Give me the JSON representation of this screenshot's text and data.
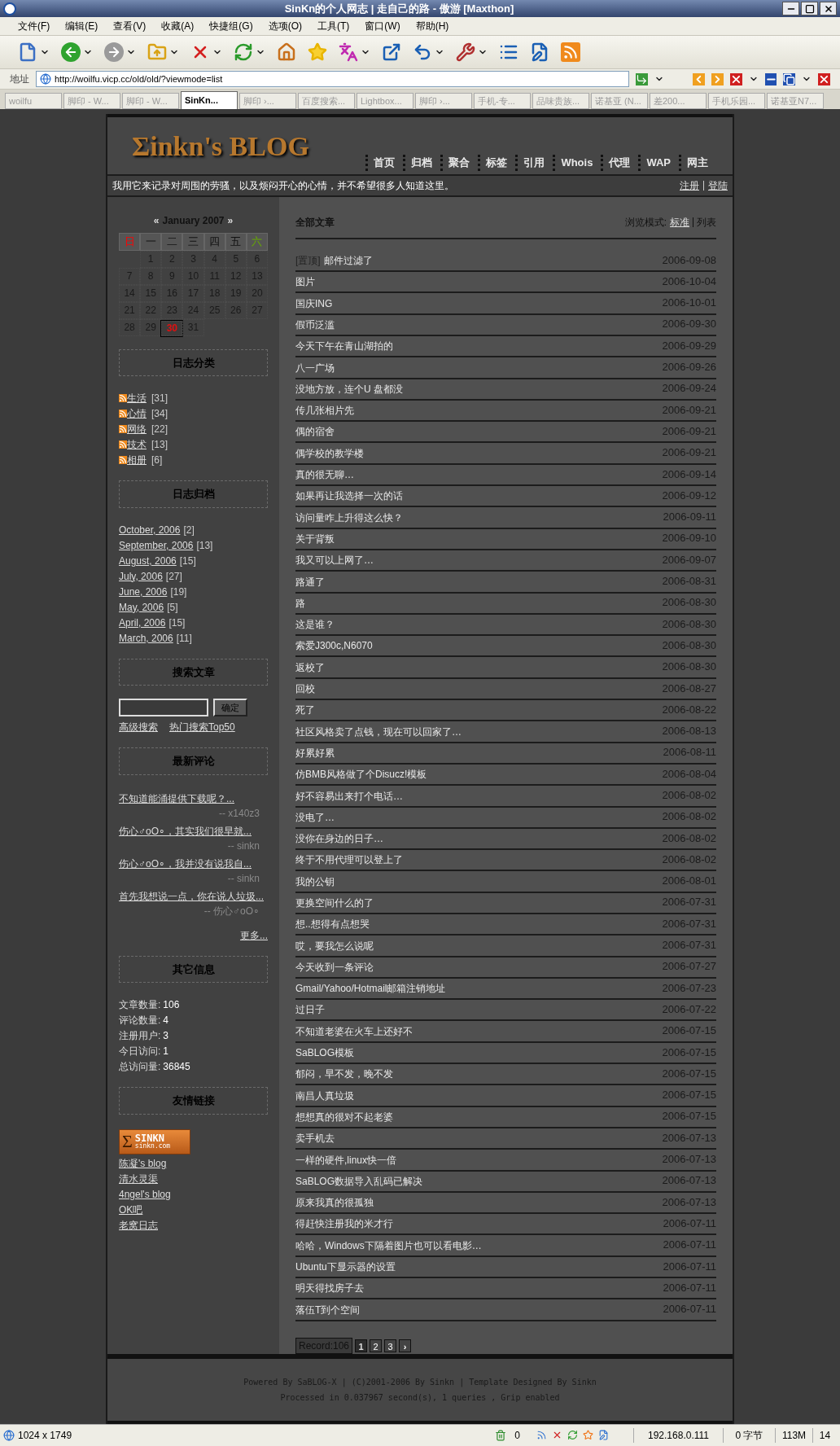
{
  "window": {
    "title": "SinKn的个人网志 | 走自己的路 - 傲游 [Maxthon]"
  },
  "menu": [
    "文件(F)",
    "编辑(E)",
    "查看(V)",
    "收藏(A)",
    "快捷组(G)",
    "选项(O)",
    "工具(T)",
    "窗口(W)",
    "帮助(H)"
  ],
  "address_bar": {
    "label": "地址",
    "url": "http://woilfu.vicp.cc/old/old/?viewmode=list"
  },
  "tabs": [
    {
      "label": "woilfu",
      "selected": false
    },
    {
      "label": "脚印 - W...",
      "selected": false
    },
    {
      "label": "脚印 - W...",
      "selected": false
    },
    {
      "label": "SinKn...",
      "selected": true
    },
    {
      "label": "脚印 ›...",
      "selected": false
    },
    {
      "label": "百度搜索...",
      "selected": false
    },
    {
      "label": "Lightbox...",
      "selected": false
    },
    {
      "label": "脚印 ›...",
      "selected": false
    },
    {
      "label": "手机-专...",
      "selected": false
    },
    {
      "label": "品味贵族...",
      "selected": false
    },
    {
      "label": "诺基亚 (N...",
      "selected": false
    },
    {
      "label": "差200...",
      "selected": false
    },
    {
      "label": "手机乐园...",
      "selected": false
    },
    {
      "label": "诺基亚N7...",
      "selected": false
    }
  ],
  "blog": {
    "logo": "Σinkn's BLOG",
    "nav": [
      "首页",
      "归档",
      "聚合",
      "标签",
      "引用",
      "Whois",
      "代理",
      "WAP",
      "网主"
    ],
    "tagline": "我用它来记录对周围的劳骚，以及烦闷开心的心情，并不希望很多人知道这里。",
    "account_links": [
      "注册",
      "登陆"
    ]
  },
  "calendar": {
    "prev": "«",
    "title": "January 2007",
    "next": "»",
    "weekdays": [
      {
        "label": "日",
        "kind": "sunday"
      },
      {
        "label": "一",
        "kind": "weekday"
      },
      {
        "label": "二",
        "kind": "weekday"
      },
      {
        "label": "三",
        "kind": "weekday"
      },
      {
        "label": "四",
        "kind": "weekday"
      },
      {
        "label": "五",
        "kind": "weekday"
      },
      {
        "label": "六",
        "kind": "saturday"
      }
    ],
    "days": [
      {
        "kind": "blank"
      },
      {
        "label": "1",
        "selected": false
      },
      {
        "label": "2",
        "selected": false
      },
      {
        "label": "3",
        "selected": false
      },
      {
        "label": "4",
        "selected": false
      },
      {
        "label": "5",
        "selected": false
      },
      {
        "label": "6",
        "selected": false
      },
      {
        "label": "7",
        "selected": false
      },
      {
        "label": "8",
        "selected": false
      },
      {
        "label": "9",
        "selected": false
      },
      {
        "label": "10",
        "selected": false
      },
      {
        "label": "11",
        "selected": false
      },
      {
        "label": "12",
        "selected": false
      },
      {
        "label": "13",
        "selected": false
      },
      {
        "label": "14",
        "selected": false
      },
      {
        "label": "15",
        "selected": false
      },
      {
        "label": "16",
        "selected": false
      },
      {
        "label": "17",
        "selected": false
      },
      {
        "label": "18",
        "selected": false
      },
      {
        "label": "19",
        "selected": false
      },
      {
        "label": "20",
        "selected": false
      },
      {
        "label": "21",
        "selected": false
      },
      {
        "label": "22",
        "selected": false
      },
      {
        "label": "23",
        "selected": false
      },
      {
        "label": "24",
        "selected": false
      },
      {
        "label": "25",
        "selected": false
      },
      {
        "label": "26",
        "selected": false
      },
      {
        "label": "27",
        "selected": false
      },
      {
        "label": "28",
        "selected": false
      },
      {
        "label": "29",
        "selected": false
      },
      {
        "label": "30",
        "selected": true
      },
      {
        "label": "31",
        "selected": false
      }
    ]
  },
  "categories": {
    "title": "日志分类",
    "items": [
      {
        "name": "生活",
        "count": "[31]"
      },
      {
        "name": "心情",
        "count": "[34]"
      },
      {
        "name": "网络",
        "count": "[22]"
      },
      {
        "name": "技术",
        "count": "[13]"
      },
      {
        "name": "相册",
        "count": "[6]"
      }
    ]
  },
  "archives": {
    "title": "日志归档",
    "items": [
      {
        "name": "October, 2006",
        "count": "[2]"
      },
      {
        "name": "September, 2006",
        "count": "[13]"
      },
      {
        "name": "August, 2006",
        "count": "[15]"
      },
      {
        "name": "July, 2006",
        "count": "[27]"
      },
      {
        "name": "June, 2006",
        "count": "[19]"
      },
      {
        "name": "May, 2006",
        "count": "[5]"
      },
      {
        "name": "April, 2006",
        "count": "[15]"
      },
      {
        "name": "March, 2006",
        "count": "[11]"
      }
    ]
  },
  "search": {
    "title": "搜索文章",
    "button": "确定",
    "links": [
      "高级搜索",
      "热门搜索Top50"
    ]
  },
  "comments": {
    "title": "最新评论",
    "items": [
      {
        "text": "不知道能涌提供下载呢？...",
        "author": "-- x140z3"
      },
      {
        "text": "伤心♂oO∘，其实我们很早就...",
        "author": "-- sinkn"
      },
      {
        "text": "伤心♂oO∘，我并没有说我自...",
        "author": "-- sinkn"
      },
      {
        "text": "首先我想说一点，你在说人垃圾...",
        "author": "-- 伤心♂oO∘"
      }
    ],
    "more": "更多..."
  },
  "stats": {
    "title": "其它信息",
    "items": [
      {
        "label": "文章数量:",
        "value": "106"
      },
      {
        "label": "评论数量:",
        "value": "4"
      },
      {
        "label": "注册用户:",
        "value": "3"
      },
      {
        "label": "今日访问:",
        "value": "1"
      },
      {
        "label": "总访问量:",
        "value": "36845"
      }
    ]
  },
  "links": {
    "title": "友情链接",
    "banner": {
      "symbol": "Σ",
      "name": "SINKN",
      "domain": "sinkn.com"
    },
    "items": [
      "陈凝's blog",
      "清水灵渠",
      "4ngel's blog",
      "OK吧",
      "老窝日志"
    ]
  },
  "articles": {
    "title": "全部文章",
    "view_label": "浏览模式:",
    "view_modes": [
      {
        "label": "标准",
        "selected": false
      },
      {
        "label": "列表",
        "selected": true
      }
    ],
    "rows": [
      {
        "pinned": "[置顶]",
        "title": "邮件过滤了",
        "date": "2006-09-08"
      },
      {
        "title": "图片",
        "date": "2006-10-04"
      },
      {
        "title": "国庆ING",
        "date": "2006-10-01"
      },
      {
        "title": "假币泛滥",
        "date": "2006-09-30"
      },
      {
        "title": "今天下午在青山湖拍的",
        "date": "2006-09-29"
      },
      {
        "title": "八一广场",
        "date": "2006-09-26"
      },
      {
        "title": "没地方放，连个U 盘都没",
        "date": "2006-09-24"
      },
      {
        "title": "传几张相片先",
        "date": "2006-09-21"
      },
      {
        "title": "偶的宿舍",
        "date": "2006-09-21"
      },
      {
        "title": "偶学校的教学楼",
        "date": "2006-09-21"
      },
      {
        "title": "真的很无聊…",
        "date": "2006-09-14"
      },
      {
        "title": "如果再让我选择一次的话",
        "date": "2006-09-12"
      },
      {
        "title": "访问量咋上升得这么快？",
        "date": "2006-09-11"
      },
      {
        "title": "关于背叛",
        "date": "2006-09-10"
      },
      {
        "title": "我又可以上网了…",
        "date": "2006-09-07"
      },
      {
        "title": "路通了",
        "date": "2006-08-31"
      },
      {
        "title": "路",
        "date": "2006-08-30"
      },
      {
        "title": "这是谁？",
        "date": "2006-08-30"
      },
      {
        "title": "索爱J300c,N6070",
        "date": "2006-08-30"
      },
      {
        "title": "返校了",
        "date": "2006-08-30"
      },
      {
        "title": "回校",
        "date": "2006-08-27"
      },
      {
        "title": "死了",
        "date": "2006-08-22"
      },
      {
        "title": "社区风格卖了点钱，现在可以回家了…",
        "date": "2006-08-13"
      },
      {
        "title": "好累好累",
        "date": "2006-08-11"
      },
      {
        "title": "仿BMB风格做了个Disucz!模板",
        "date": "2006-08-04"
      },
      {
        "title": "好不容易出来打个电话…",
        "date": "2006-08-02"
      },
      {
        "title": "没电了…",
        "date": "2006-08-02"
      },
      {
        "title": "没你在身边的日子…",
        "date": "2006-08-02"
      },
      {
        "title": "终于不用代理可以登上了",
        "date": "2006-08-02"
      },
      {
        "title": "我的公钥",
        "date": "2006-08-01"
      },
      {
        "title": "更换空间什么的了",
        "date": "2006-07-31"
      },
      {
        "title": "想..想得有点想哭",
        "date": "2006-07-31"
      },
      {
        "title": "哎，要我怎么说呢",
        "date": "2006-07-31"
      },
      {
        "title": "今天收到一条评论",
        "date": "2006-07-27"
      },
      {
        "title": "Gmail/Yahoo/Hotmail邮箱注销地址",
        "date": "2006-07-23"
      },
      {
        "title": "过日子",
        "date": "2006-07-22"
      },
      {
        "title": "不知道老婆在火车上还好不",
        "date": "2006-07-15"
      },
      {
        "title": "SaBLOG模板",
        "date": "2006-07-15"
      },
      {
        "title": "郁闷，早不发，晚不发",
        "date": "2006-07-15"
      },
      {
        "title": "南昌人真垃圾",
        "date": "2006-07-15"
      },
      {
        "title": "想想真的很对不起老婆",
        "date": "2006-07-15"
      },
      {
        "title": "卖手机去",
        "date": "2006-07-13"
      },
      {
        "title": "一样的硬件,linux快一倍",
        "date": "2006-07-13"
      },
      {
        "title": "SaBLOG数据导入乱码已解决",
        "date": "2006-07-13"
      },
      {
        "title": "原来我真的很孤独",
        "date": "2006-07-13"
      },
      {
        "title": "得赶快注册我的米才行",
        "date": "2006-07-11"
      },
      {
        "title": "哈哈，Windows下隔着图片也可以看电影…",
        "date": "2006-07-11"
      },
      {
        "title": "Ubuntu下显示器的设置",
        "date": "2006-07-11"
      },
      {
        "title": "明天得找房子去",
        "date": "2006-07-11"
      },
      {
        "title": "落伍T到个空间",
        "date": "2006-07-11"
      }
    ],
    "pagination": {
      "record": "Record:106",
      "pages": [
        {
          "label": "1",
          "selected": true
        },
        {
          "label": "2",
          "selected": false
        },
        {
          "label": "3",
          "selected": false
        }
      ],
      "next": "›"
    }
  },
  "footer": [
    "Powered By SaBLOG-X | (C)2001-2006 By Sinkn | Template Designed By Sinkn",
    "Processed in 0.037967 second(s), 1 queries , Grip enabled"
  ],
  "status_bar": {
    "size": "1024 x 1749",
    "count": "0",
    "ip": "192.168.0.111",
    "bytes": "0 字节",
    "memory": "113M",
    "number": "14"
  }
}
